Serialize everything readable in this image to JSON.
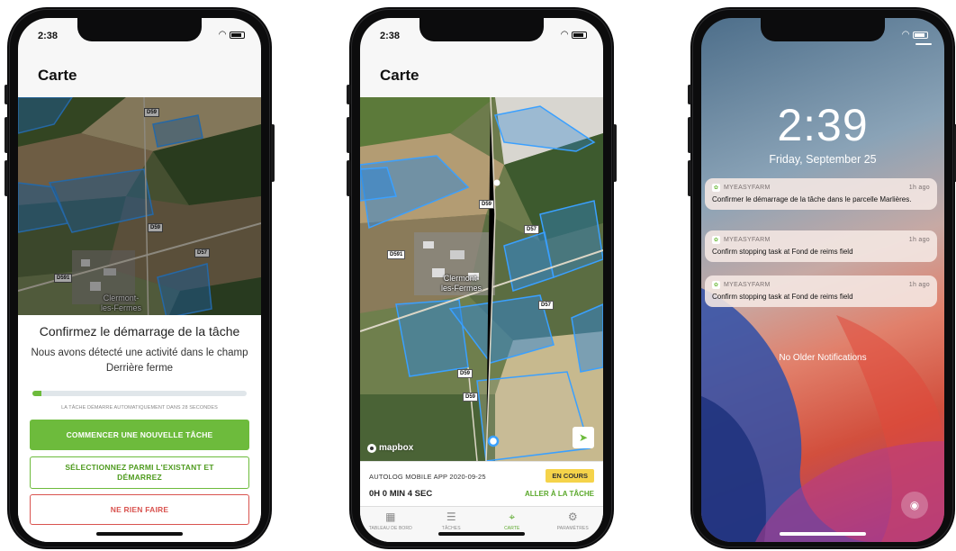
{
  "phone1": {
    "status_time": "2:38",
    "nav_title": "Carte",
    "map": {
      "roads": [
        "D59",
        "D59",
        "D57",
        "D591"
      ],
      "town": [
        "Clermont-",
        "les-Fermes"
      ]
    },
    "modal": {
      "title": "Confirmez le démarrage de la tâche",
      "message": "Nous avons détecté une activité dans le champ Derrière ferme",
      "progress": 0.04,
      "countdown": "LA TÂCHE DÉMARRE AUTOMATIQUEMENT DANS 28 SECONDES",
      "primary_button": "COMMENCER UNE NOUVELLE TÂCHE",
      "secondary_button": "SÉLECTIONNEZ PARMI L'EXISTANT ET DÉMARREZ",
      "danger_button": "NE RIEN FAIRE"
    }
  },
  "phone2": {
    "status_time": "2:38",
    "nav_title": "Carte",
    "map": {
      "roads": [
        "D59",
        "D57",
        "D591",
        "D57",
        "D59",
        "D59"
      ],
      "town": [
        "Clermont-",
        "les-Fermes"
      ],
      "attribution": "mapbox"
    },
    "task_card": {
      "task_name": "AUTOLOG MOBILE APP 2020-09-25",
      "status_badge": "EN COURS",
      "duration": "0H 0 MIN 4 SEC",
      "go_to_task": "ALLER À LA TÂCHE"
    },
    "tabs": [
      {
        "label": "TABLEAU DE BORD",
        "icon": "dashboard-icon",
        "glyph": "▦",
        "active": false
      },
      {
        "label": "TÂCHES",
        "icon": "list-icon",
        "glyph": "☰",
        "active": false
      },
      {
        "label": "CARTE",
        "icon": "map-pin-icon",
        "glyph": "⌖",
        "active": true
      },
      {
        "label": "PARAMÈTRES",
        "icon": "sliders-icon",
        "glyph": "⚙",
        "active": false
      }
    ]
  },
  "phone3": {
    "time": "2:39",
    "date": "Friday, September 25",
    "notifications": [
      {
        "app": "MYEASYFARM",
        "ago": "1h ago",
        "body": "Confirmer le démarrage de la tâche dans le parcelle Marlières."
      },
      {
        "app": "MYEASYFARM",
        "ago": "1h ago",
        "body": "Confirm stopping task at Fond de reims field"
      },
      {
        "app": "MYEASYFARM",
        "ago": "1h ago",
        "body": "Confirm stopping task at Fond de reims field"
      }
    ],
    "no_older": "No Older Notifications"
  },
  "colors": {
    "brand_green": "#6dbb3c",
    "danger_red": "#d9534f",
    "badge_yellow": "#f5d34a",
    "field_blue": "#2f86d6"
  }
}
